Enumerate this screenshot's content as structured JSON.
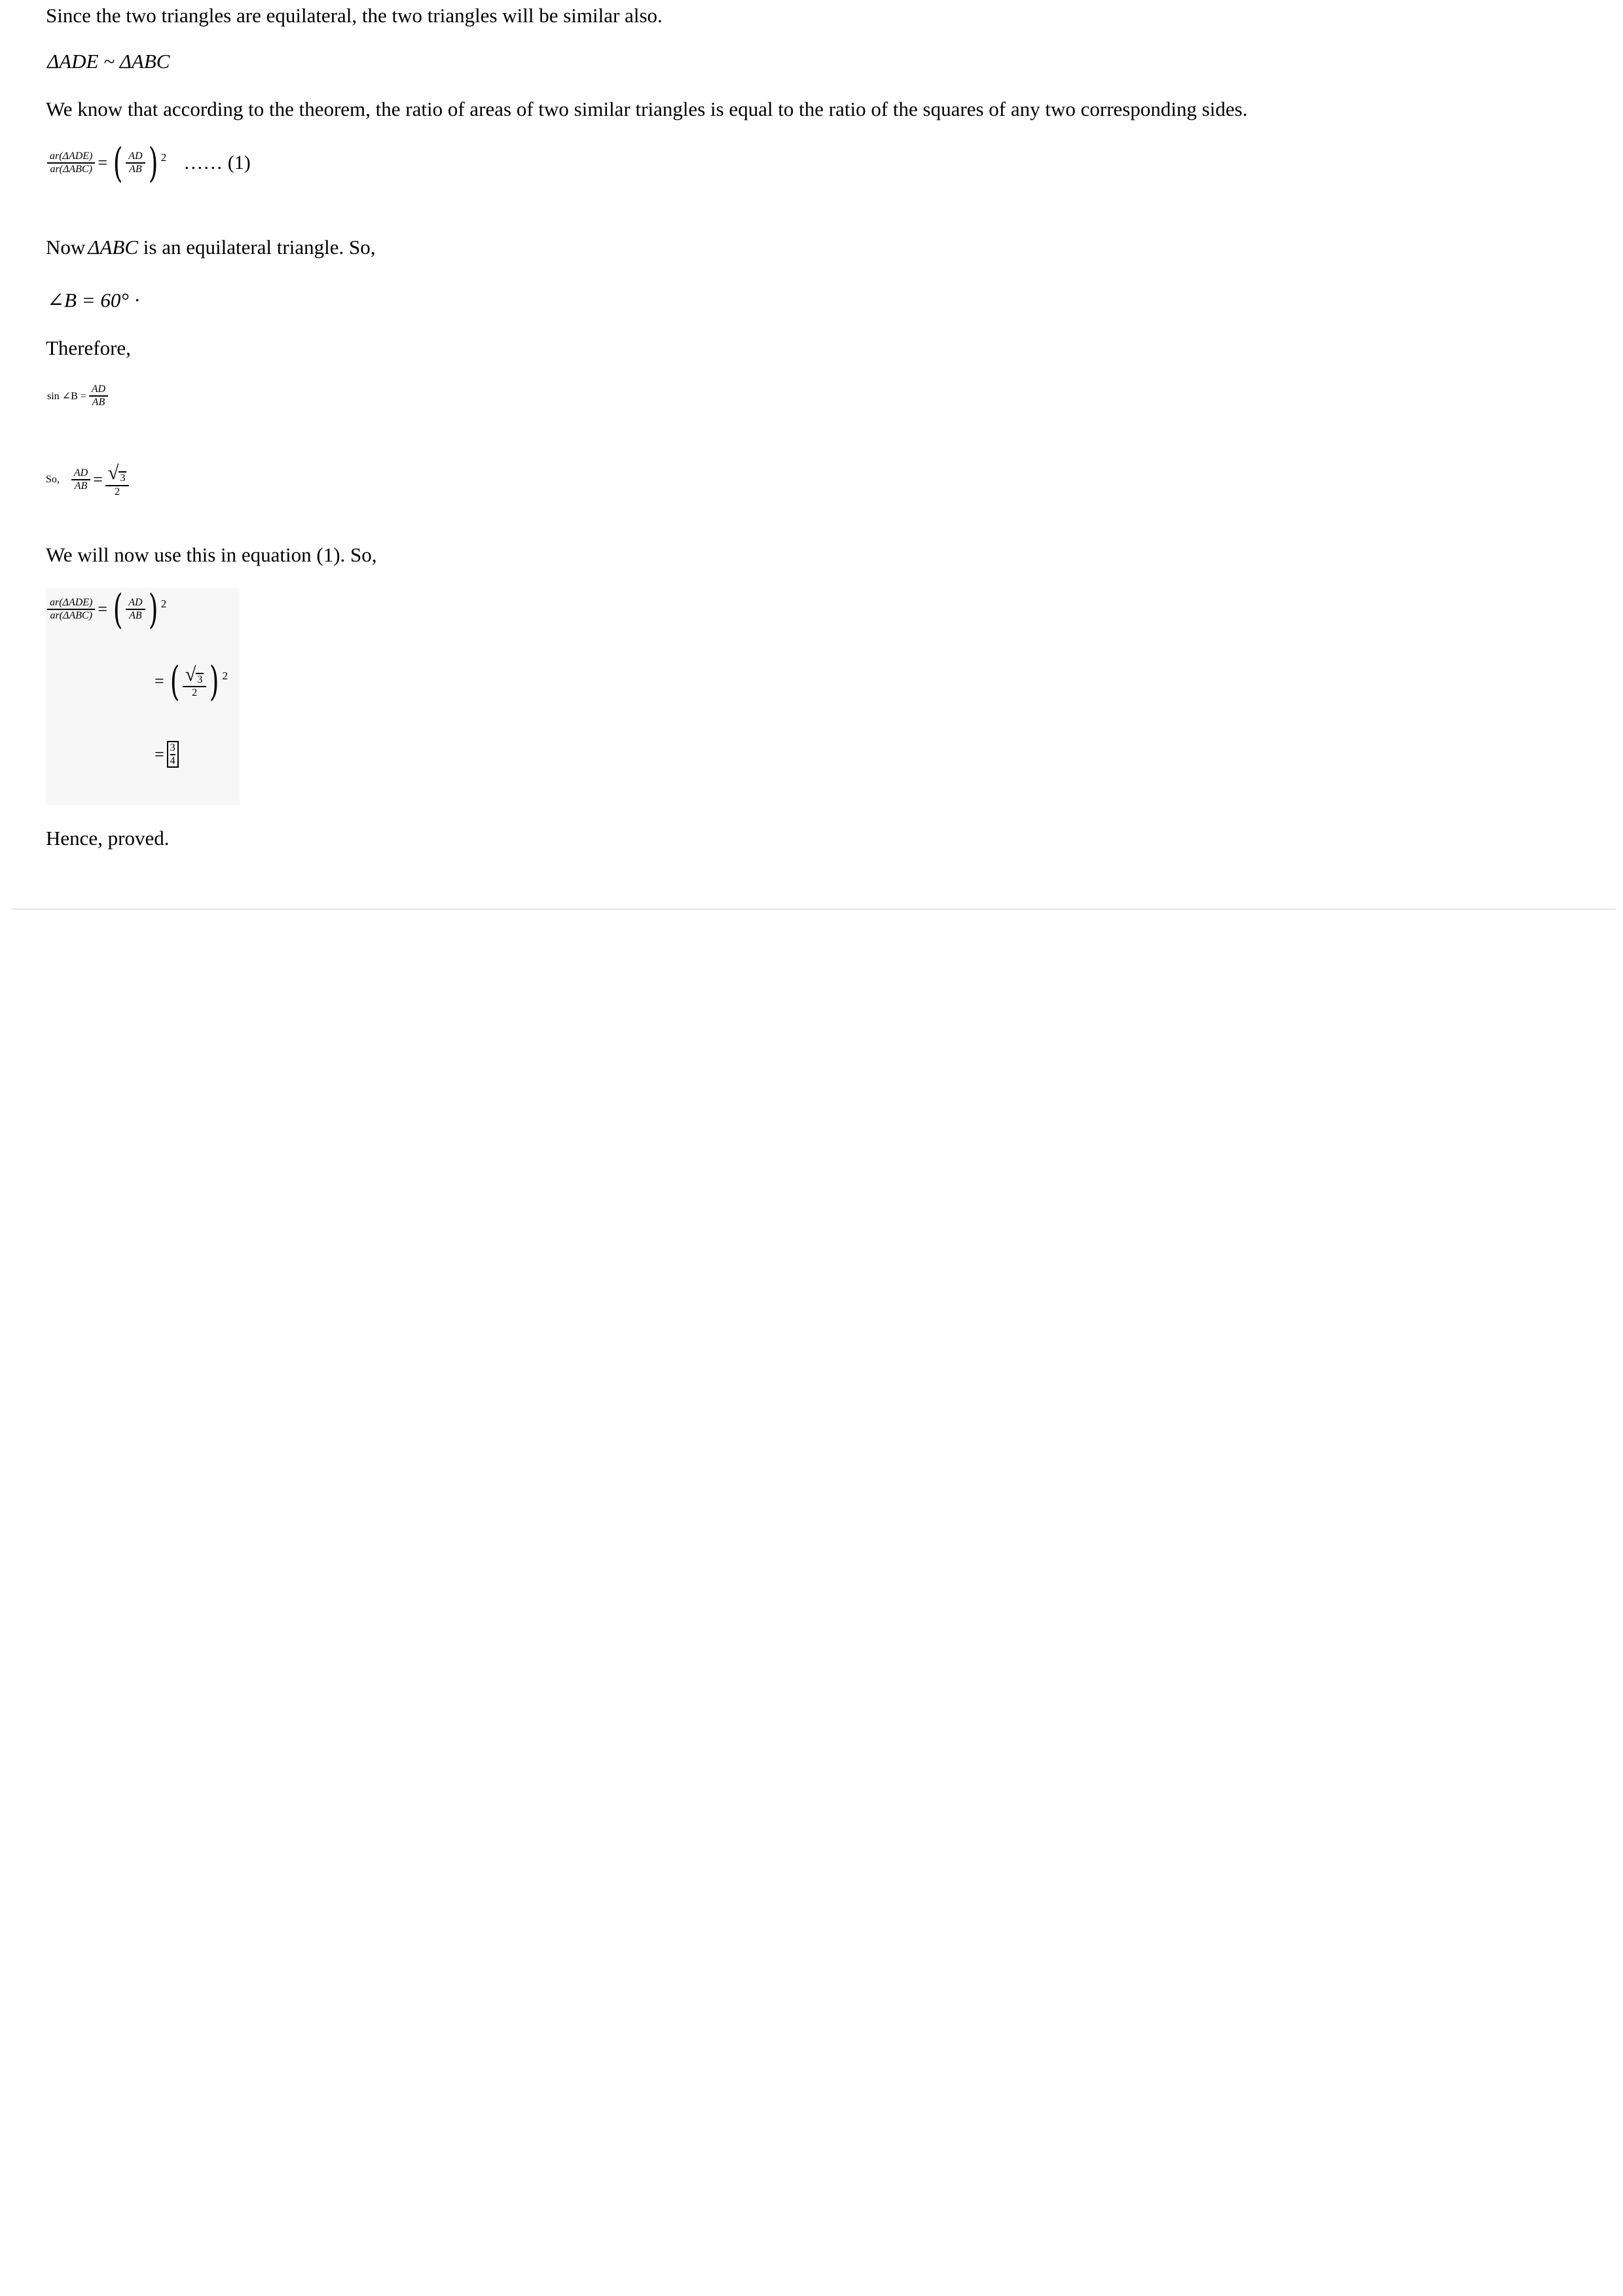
{
  "text": {
    "line1": "Since the two triangles are equilateral, the two triangles will be similar also.",
    "line3": "We know that according to the theorem, the ratio of areas of two similar triangles is equal to the ratio of the squares of any two corresponding sides.",
    "line5_prefix": "Now",
    "line5_suffix": " is an equilateral triangle. So,",
    "line7": "Therefore,",
    "line9_prefix": "So,",
    "line10": "We will now use this in equation (1). So,",
    "line12": "Hence, proved."
  },
  "math": {
    "similar": "ΔADE ~ ΔABC",
    "ar_ade": "ar(ΔADE)",
    "ar_abc": "ar(ΔABC)",
    "ad": "AD",
    "ab": "AB",
    "exp": "2",
    "eq1_label": "…… (1)",
    "abc": "ΔABC",
    "angleB": "∠B = 60°",
    "angleB_dot": "·",
    "sinB": "sin ∠B =",
    "three": "3",
    "two": "2",
    "four": "4",
    "eq": "="
  }
}
